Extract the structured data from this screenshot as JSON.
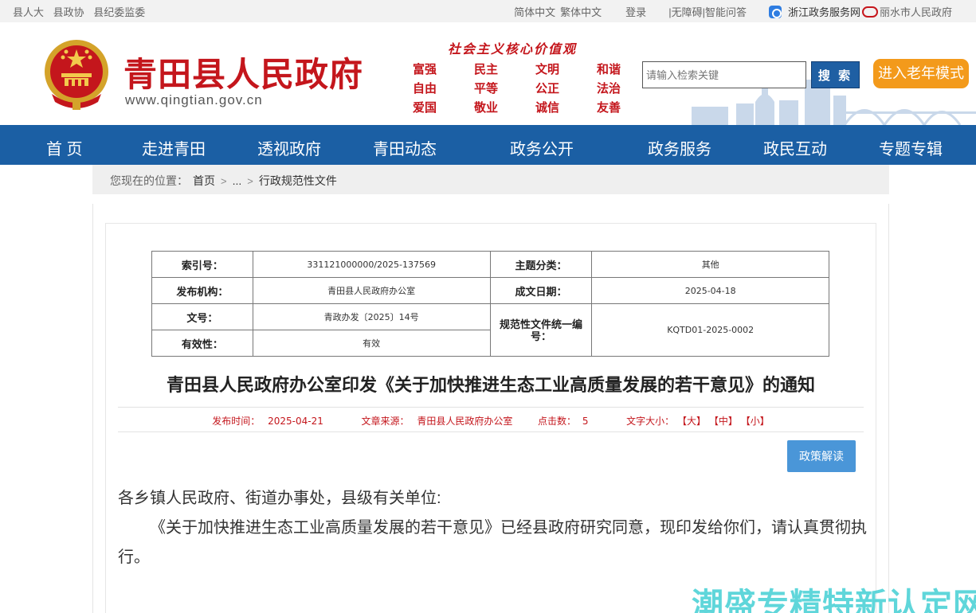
{
  "topbar": {
    "links_left": [
      "县人大",
      "县政协",
      "县纪委监委"
    ],
    "simplified": "简体中文",
    "traditional": "繁体中文",
    "login": "登录",
    "accessibility": "|无障碍|",
    "smart_qa": "智能问答",
    "zhejiang_service": "浙江政务服务网",
    "lishui_gov": "丽水市人民政府"
  },
  "header": {
    "site_title": "青田县人民政府",
    "site_url": "www.qingtian.gov.cn",
    "values_title": "社会主义核心价值观",
    "values": [
      "富强",
      "民主",
      "文明",
      "和谐",
      "自由",
      "平等",
      "公正",
      "法治",
      "爱国",
      "敬业",
      "诚信",
      "友善"
    ],
    "search_placeholder": "请输入检索关键",
    "search_button": "搜 索",
    "elder_mode": "进入老年模式"
  },
  "nav": [
    "首 页",
    "走进青田",
    "透视政府",
    "青田动态",
    "政务公开",
    "政务服务",
    "政民互动",
    "专题专辑"
  ],
  "breadcrumb": {
    "label": "您现在的位置：",
    "home": "首页",
    "ellipsis": "...",
    "current": "行政规范性文件"
  },
  "meta": {
    "index_no_label": "索引号：",
    "index_no": "331121000000/2025-137569",
    "topic_label": "主题分类：",
    "topic": "其他",
    "publisher_label": "发布机构：",
    "publisher": "青田县人民政府办公室",
    "date_label": "成文日期：",
    "date": "2025-04-18",
    "doc_no_label": "文号：",
    "doc_no": "青政办发〔2025〕14号",
    "code_label": "规范性文件统一编号：",
    "code": "KQTD01-2025-0002",
    "validity_label": "有效性：",
    "validity": "有效"
  },
  "article": {
    "title": "青田县人民政府办公室印发《关于加快推进生态工业高质量发展的若干意见》的通知",
    "publish_time_label": "发布时间：",
    "publish_time": "2025-04-21",
    "source_label": "文章来源：",
    "source": "青田县人民政府办公室",
    "clicks_label": "点击数：",
    "clicks": "5",
    "font_size_label": "文字大小：",
    "size_large": "【大】",
    "size_medium": "【中】",
    "size_small": "【小】",
    "policy_button": "政策解读",
    "salutation": "各乡镇人民政府、街道办事处，县级有关单位:",
    "paragraph": "《关于加快推进生态工业高质量发展的若干意见》已经县政府研究同意，现印发给你们，请认真贯彻执行。"
  },
  "watermark": "潮盛专精特新认定网",
  "colors": {
    "brand_red": "#c4161c",
    "nav_blue": "#1b5fa4",
    "elder_orange": "#f39a1b",
    "policy_blue": "#4a96d8"
  }
}
